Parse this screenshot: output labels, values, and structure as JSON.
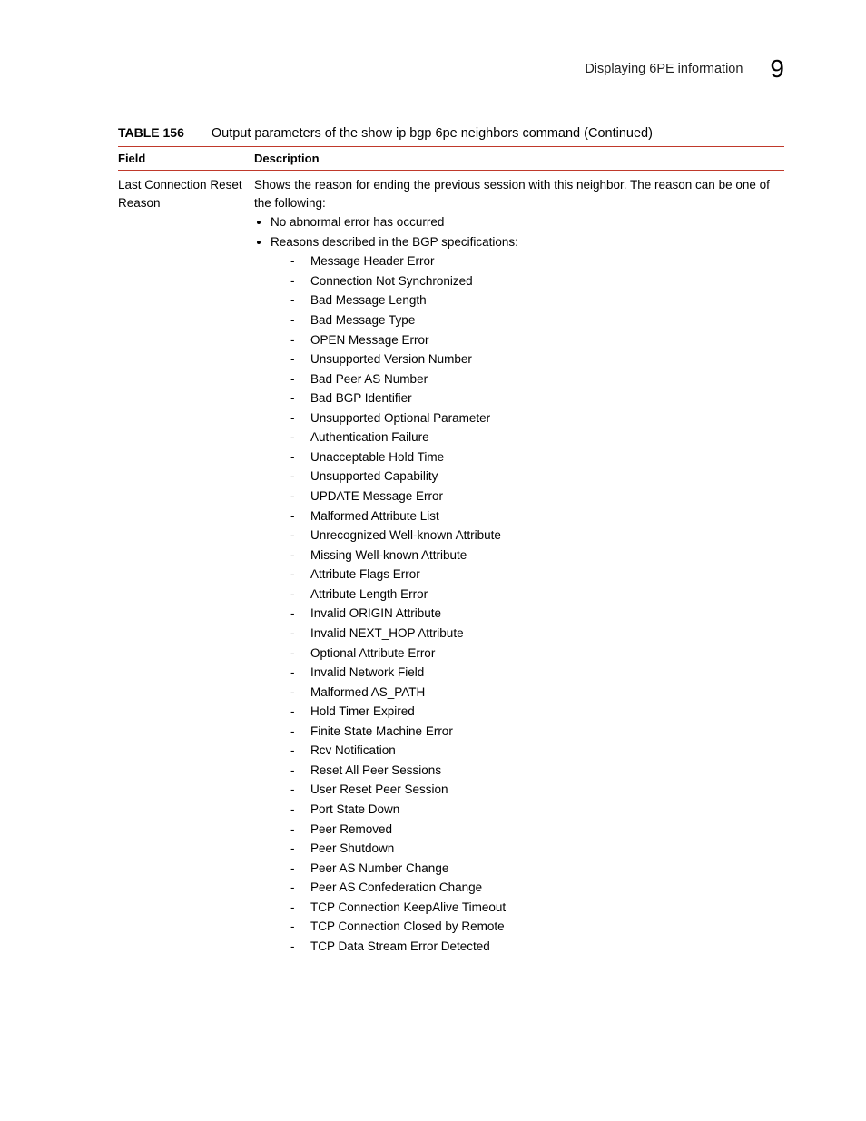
{
  "header": {
    "section_title": "Displaying 6PE information",
    "chapter_number": "9"
  },
  "table": {
    "number": "TABLE 156",
    "caption": "Output parameters of the show ip bgp 6pe neighbors command  (Continued)",
    "columns": {
      "field": "Field",
      "description": "Description"
    },
    "row": {
      "field": "Last Connection Reset Reason",
      "intro": "Shows the reason for ending the previous session with this neighbor. The reason can be one of the following:",
      "bullet1": "No abnormal error has occurred",
      "bullet2": "Reasons described in the BGP specifications:",
      "reasons": [
        "Message Header Error",
        "Connection Not Synchronized",
        "Bad Message Length",
        "Bad Message Type",
        "OPEN Message Error",
        "Unsupported Version Number",
        "Bad Peer AS Number",
        "Bad BGP Identifier",
        "Unsupported Optional Parameter",
        "Authentication Failure",
        "Unacceptable Hold Time",
        "Unsupported Capability",
        "UPDATE Message Error",
        "Malformed Attribute List",
        "Unrecognized Well-known Attribute",
        "Missing Well-known Attribute",
        "Attribute Flags Error",
        "Attribute Length Error",
        "Invalid ORIGIN Attribute",
        "Invalid NEXT_HOP Attribute",
        "Optional Attribute Error",
        "Invalid Network Field",
        "Malformed AS_PATH",
        "Hold Timer Expired",
        "Finite State Machine Error",
        "Rcv Notification",
        "Reset All Peer Sessions",
        "User Reset Peer Session",
        "Port State Down",
        "Peer Removed",
        "Peer Shutdown",
        "Peer AS Number Change",
        "Peer AS Confederation Change",
        "TCP Connection KeepAlive Timeout",
        "TCP Connection Closed by Remote",
        "TCP Data Stream Error Detected"
      ]
    }
  }
}
